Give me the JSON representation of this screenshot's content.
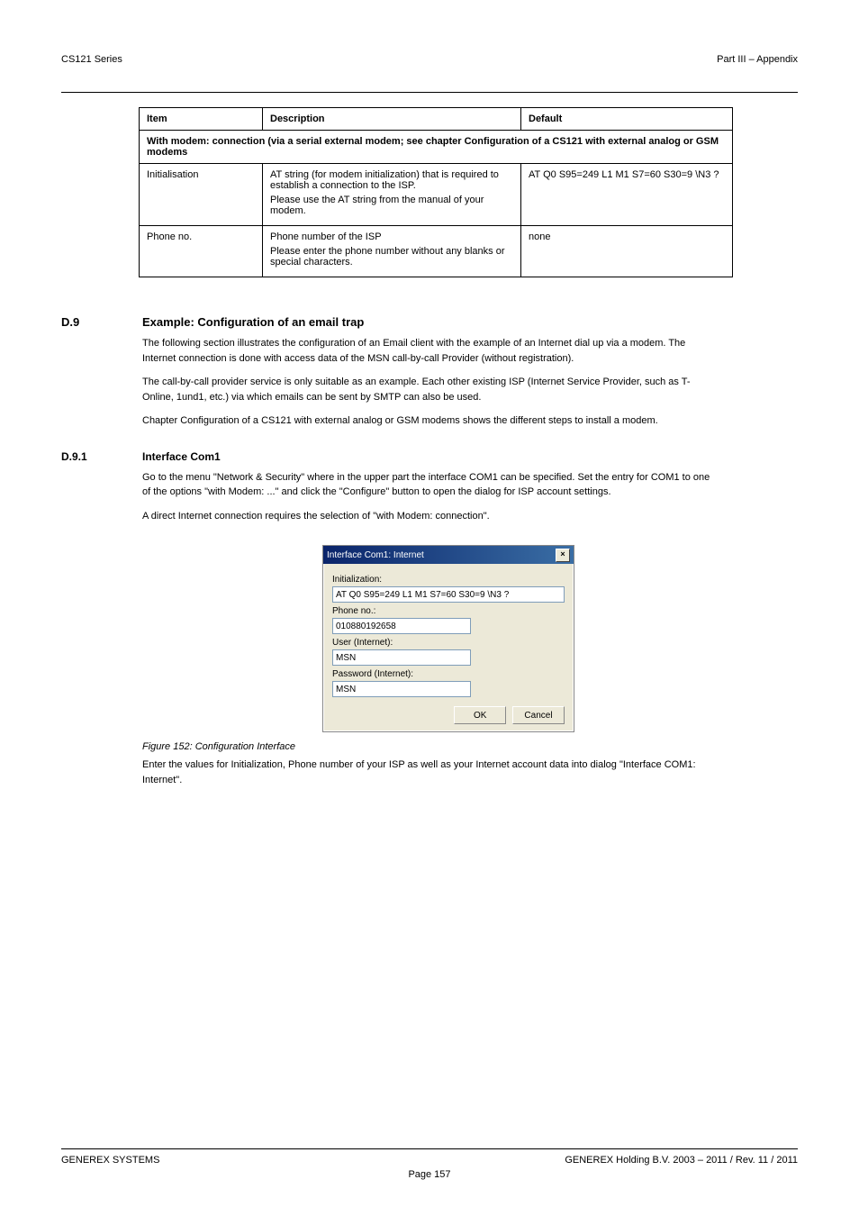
{
  "header": {
    "left": "CS121 Series",
    "right": "Part III – Appendix"
  },
  "table": {
    "cols": [
      "Item",
      "Description",
      "Default"
    ],
    "span_row": "With modem: connection (via a serial external modem; see chapter Configuration of a CS121 with external analog or GSM modems",
    "rows": [
      {
        "item": "Initialisation",
        "desc_lines": [
          "AT string (for modem initialization) that is required to establish a connection to the ISP.",
          "Please use the AT string from the manual of your modem."
        ],
        "default": "AT Q0 S95=249 L1 M1 S7=60 S30=9 \\N3 ?"
      },
      {
        "item": "Phone no.",
        "desc_lines": [
          "Phone number of the ISP",
          "Please enter the phone number without any blanks or special characters."
        ],
        "default": "none"
      }
    ]
  },
  "sec_d9": {
    "num": "D.9",
    "title": "Example: Configuration of an email trap",
    "body": [
      "The following section illustrates the configuration of an Email client with the example of an Internet dial up via a modem. The Internet connection is done with access data of the MSN call-by-call Provider (without registration).",
      "The call-by-call provider service is only suitable as an example. Each other existing ISP (Internet Service Provider, such as T-Online, 1und1, etc.) via which emails can be sent by SMTP can also be used.",
      "Chapter Configuration of a CS121 with external analog or GSM modems shows the different steps to install a modem."
    ]
  },
  "sec_d91": {
    "num": "D.9.1",
    "title": "Interface Com1",
    "body": [
      "Go to the menu \"Network & Security\" where in the upper part the interface COM1 can be specified. Set the entry for COM1 to one of the options \"with Modem: ...\" and click the \"Configure\" button to open the dialog for ISP account settings.",
      "A direct Internet connection requires the selection of \"with Modem: connection\"."
    ]
  },
  "figure": {
    "caption": "Figure 152: Configuration Interface",
    "after": "Enter the values for Initialization, Phone number of your ISP as well as your Internet account data into dialog \"Interface COM1: Internet\"."
  },
  "dialog": {
    "title": "Interface Com1: Internet",
    "close": "×",
    "fields": {
      "init_label": "Initialization:",
      "init_value": "AT Q0 S95=249 L1 M1 S7=60 S30=9 \\N3 ?",
      "phone_label": "Phone no.:",
      "phone_value": "010880192658",
      "user_label": "User (Internet):",
      "user_value": "MSN",
      "pass_label": "Password (Internet):",
      "pass_value": "MSN"
    },
    "ok": "OK",
    "cancel": "Cancel"
  },
  "footer": {
    "left": "GENEREX SYSTEMS",
    "right": "GENEREX Holding B.V. 2003 – 2011 / Rev. 11 / 2011",
    "page": "Page 157"
  }
}
